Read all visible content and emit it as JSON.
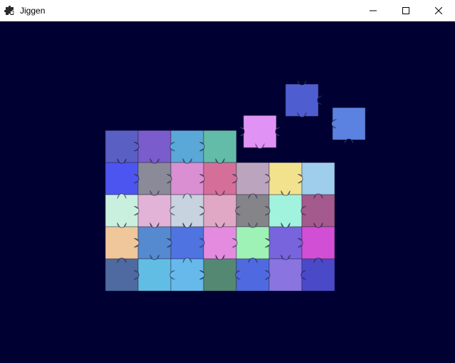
{
  "window": {
    "title": "Jiggen",
    "app_icon": "jigsaw-piece-icon",
    "controls": [
      "minimize-icon",
      "maximize-icon",
      "close-icon"
    ]
  },
  "canvas": {
    "background": "#000033"
  },
  "puzzle": {
    "columns": 7,
    "rows": 5,
    "row_colors": [
      [
        "#5a5fc4",
        "#7b5ccc",
        "#5aa8d8",
        "#63bca8",
        null,
        null,
        null
      ],
      [
        "#4d55f0",
        "#8a8a98",
        "#d98fd2",
        "#d56f9a",
        "#bba4bd",
        "#f2e28e",
        "#9fcdec"
      ],
      [
        "#c9f0df",
        "#e2b3d6",
        "#c7d3de",
        "#e0a8c5",
        "#858589",
        "#a2f3dd",
        "#a45a8d"
      ],
      [
        "#f0c69b",
        "#558ad0",
        "#4f73e0",
        "#e48be0",
        "#9ef2b5",
        "#7864dd",
        "#d04fd4"
      ],
      [
        "#4e6aa0",
        "#62bde4",
        "#67b9ec",
        "#548872",
        "#4f6ae0",
        "#8a74e0",
        "#4a49c8"
      ]
    ],
    "loose_pieces": [
      {
        "color": "#e093f4"
      },
      {
        "color": "#4e5ed0"
      },
      {
        "color": "#5b82e0"
      }
    ]
  }
}
